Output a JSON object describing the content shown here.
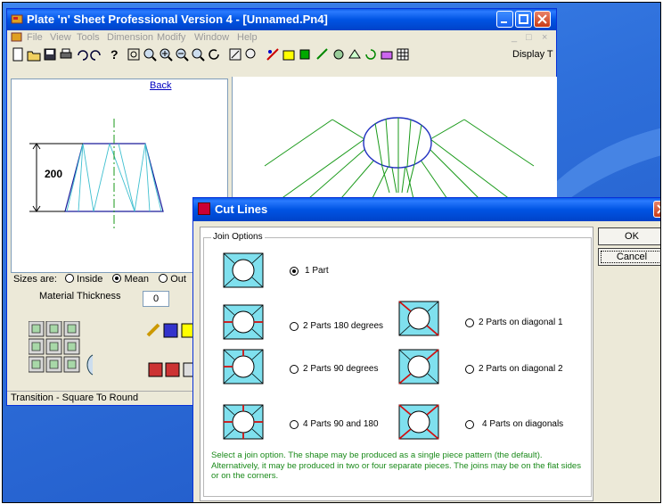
{
  "app": {
    "title": "Plate 'n' Sheet Professional Version 4 - [Unnamed.Pn4]",
    "menu": [
      "File",
      "View",
      "Tools",
      "Dimension",
      "Modify",
      "Window",
      "Help"
    ],
    "toolbar_right_label": "Display T"
  },
  "preview": {
    "back_link": "Back",
    "dimension": "200"
  },
  "options_panel": {
    "sizes_label": "Sizes are:",
    "sizes_options": [
      "Inside",
      "Mean",
      "Out"
    ],
    "sizes_selected": "Mean",
    "material_thickness_label": "Material Thickness",
    "material_thickness_value": "0"
  },
  "status": "Transition - Square To Round",
  "dialog": {
    "title": "Cut Lines",
    "group_label": "Join Options",
    "options": [
      {
        "label": "1 Part",
        "selected": true
      },
      {
        "label": "2 Parts 180 degrees",
        "selected": false
      },
      {
        "label": "2 Parts on diagonal 1",
        "selected": false
      },
      {
        "label": "2 Parts 90 degrees",
        "selected": false
      },
      {
        "label": "2 Parts on diagonal 2",
        "selected": false
      },
      {
        "label": "4 Parts 90 and 180",
        "selected": false
      },
      {
        "label": "4 Parts on diagonals",
        "selected": false
      }
    ],
    "help_text": "Select a join option. The shape may be produced as a single piece pattern (the default). Alternatively, it may be produced in two or four separate pieces. The joins may be on the flat sides or on the corners.",
    "ok_label": "OK",
    "cancel_label": "Cancel"
  },
  "colors": {
    "titlebar": "#0054e3",
    "shape_fill": "#7fe0ee",
    "cut_line": "#d01010",
    "help_text": "#1a8a1a",
    "drawing_line": "#1a9a1a",
    "drawing_ellipse": "#2030c0"
  }
}
